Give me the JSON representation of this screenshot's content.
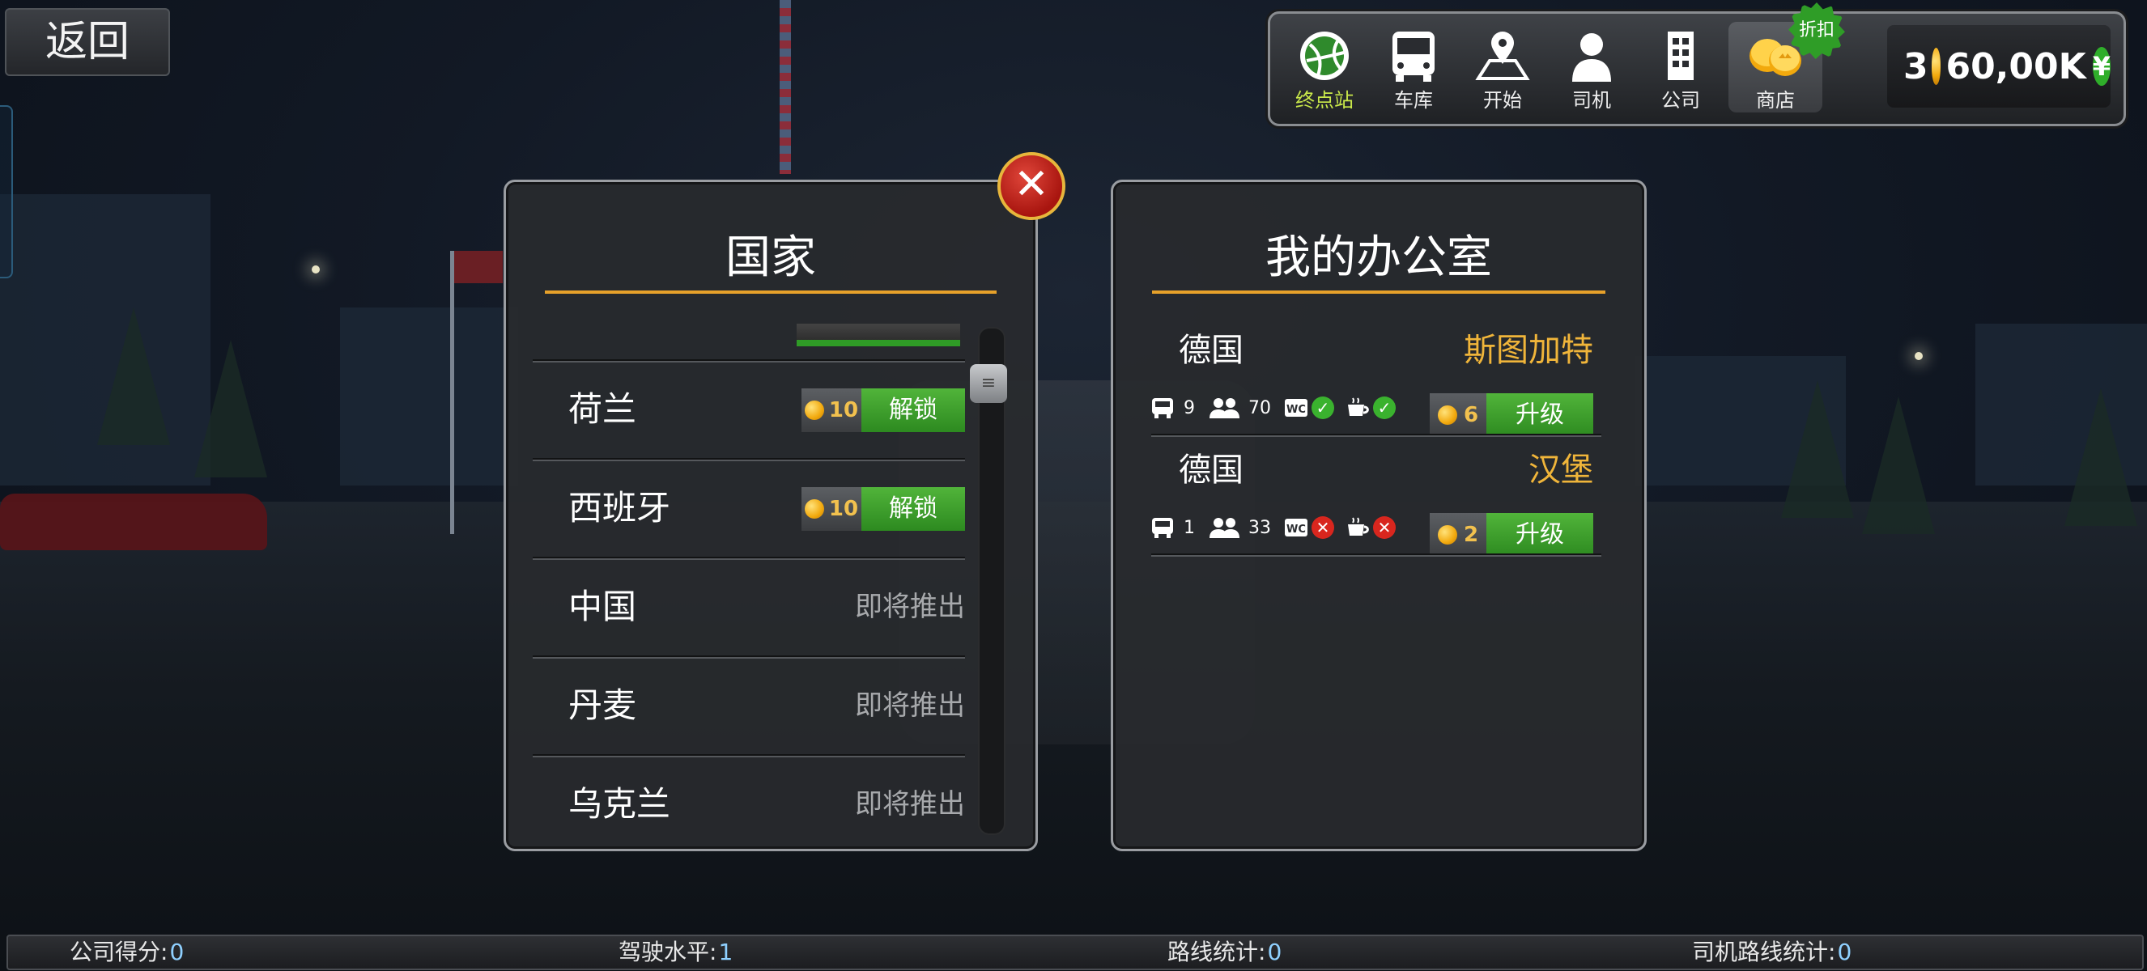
{
  "back_button": {
    "label": "返回"
  },
  "nav": {
    "items": [
      {
        "label": "终点站",
        "icon": "globe-icon",
        "active": true
      },
      {
        "label": "车库",
        "icon": "bus-icon"
      },
      {
        "label": "开始",
        "icon": "map-pin-icon"
      },
      {
        "label": "司机",
        "icon": "driver-icon"
      },
      {
        "label": "公司",
        "icon": "building-icon"
      },
      {
        "label": "商店",
        "icon": "coins-icon"
      }
    ],
    "discount_badge": "折扣"
  },
  "currency": {
    "gold": "3",
    "money": "60,00K",
    "money_symbol": "¥"
  },
  "countries_panel": {
    "title": "国家",
    "rows": [
      {
        "name": "荷兰",
        "price": "10",
        "action": "解锁"
      },
      {
        "name": "西班牙",
        "price": "10",
        "action": "解锁"
      },
      {
        "name": "中国",
        "status": "即将推出"
      },
      {
        "name": "丹麦",
        "status": "即将推出"
      },
      {
        "name": "乌克兰",
        "status": "即将推出"
      }
    ],
    "scroll_thumb": "≡"
  },
  "office_panel": {
    "title": "我的办公室",
    "offices": [
      {
        "country": "德国",
        "city": "斯图加特",
        "buses": "9",
        "drivers": "70",
        "wc": "WC",
        "wc_ok": true,
        "cafe_ok": true,
        "upgrade_price": "6",
        "upgrade_label": "升级"
      },
      {
        "country": "德国",
        "city": "汉堡",
        "buses": "1",
        "drivers": "33",
        "wc": "WC",
        "wc_ok": false,
        "cafe_ok": false,
        "upgrade_price": "2",
        "upgrade_label": "升级"
      }
    ]
  },
  "status_bar": {
    "company_score_label": "公司得分:",
    "company_score": "0",
    "driving_level_label": "驾驶水平:",
    "driving_level": "1",
    "route_stats_label": "路线统计:",
    "route_stats": "0",
    "driver_route_stats_label": "司机路线统计:",
    "driver_route_stats": "0"
  },
  "colors": {
    "accent_gold": "#e7a12a",
    "button_green": "#2d8a20",
    "city_orange": "#f0b53a",
    "active_nav": "#c9e84a"
  }
}
